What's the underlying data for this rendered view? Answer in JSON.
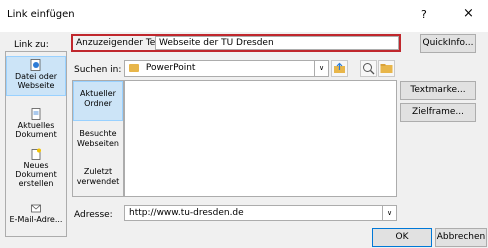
{
  "window": {
    "title": "Link einfügen",
    "help": "?",
    "close": "×"
  },
  "left": {
    "label": "Link zu:",
    "items": [
      {
        "label": "Datei oder Webseite",
        "icon": "globe-page-icon",
        "selected": true
      },
      {
        "label": "Aktuelles Dokument",
        "icon": "document-icon",
        "selected": false
      },
      {
        "label": "Neues Dokument erstellen",
        "icon": "new-document-icon",
        "selected": false
      },
      {
        "label": "E-Mail-Adre...",
        "icon": "email-icon",
        "selected": false
      }
    ]
  },
  "display_text": {
    "label": "Anzuzeigender Text:",
    "value": "Webseite der TU Dresden"
  },
  "quickinfo": "QuickInfo...",
  "search": {
    "label": "Suchen in:",
    "value": "PowerPoint"
  },
  "middle_nav": [
    {
      "label": "Aktueller Ordner",
      "selected": true
    },
    {
      "label": "Besuchte Webseiten",
      "selected": false
    },
    {
      "label": "Zuletzt verwendet",
      "selected": false
    }
  ],
  "right_buttons": {
    "textmarke": "Textmarke...",
    "zielframe": "Zielframe..."
  },
  "address": {
    "label": "Adresse:",
    "value": "http://www.tu-dresden.de"
  },
  "footer": {
    "ok": "OK",
    "cancel": "Abbrechen"
  }
}
